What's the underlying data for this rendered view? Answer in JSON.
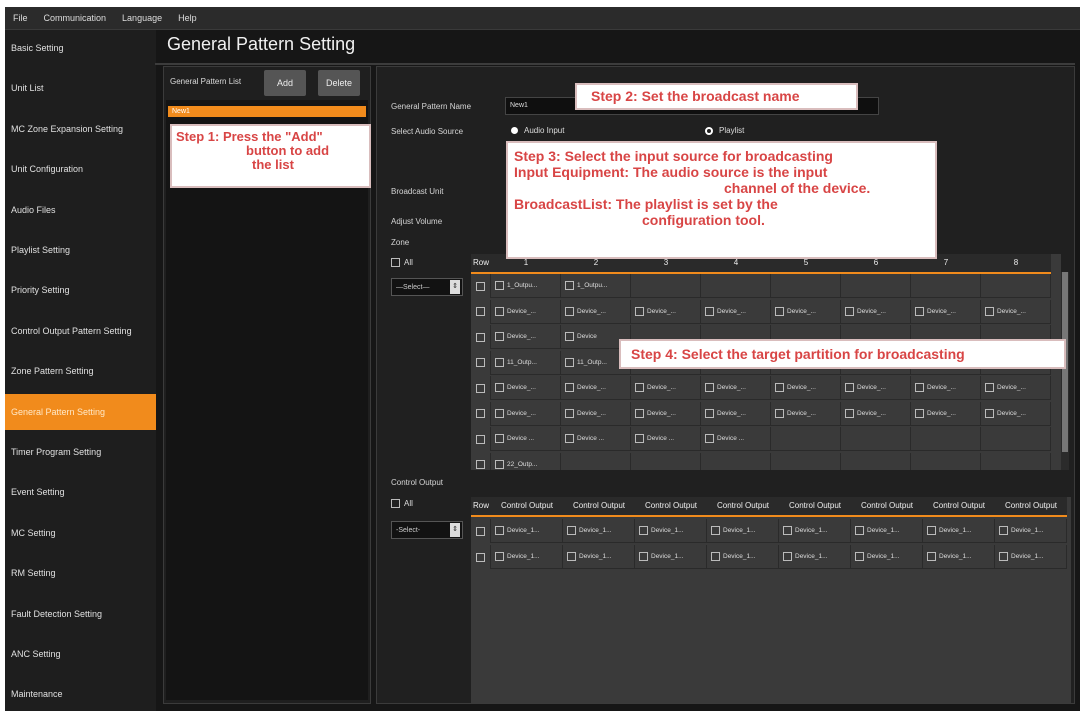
{
  "menu": [
    "File",
    "Communication",
    "Language",
    "Help"
  ],
  "sidebar": {
    "items": [
      {
        "label": "Basic Setting"
      },
      {
        "label": "Unit List"
      },
      {
        "label": "MC Zone Expansion Setting"
      },
      {
        "label": "Unit Configuration"
      },
      {
        "label": "Audio Files"
      },
      {
        "label": "Playlist Setting"
      },
      {
        "label": "Priority Setting"
      },
      {
        "label": "Control Output Pattern Setting"
      },
      {
        "label": "Zone Pattern Setting"
      },
      {
        "label": "General Pattern Setting",
        "active": true
      },
      {
        "label": "Timer Program Setting"
      },
      {
        "label": "Event Setting"
      },
      {
        "label": "MC Setting"
      },
      {
        "label": "RM Setting"
      },
      {
        "label": "Fault Detection Setting"
      },
      {
        "label": "ANC Setting"
      },
      {
        "label": "Maintenance"
      }
    ]
  },
  "page_title": "General Pattern Setting",
  "list_panel": {
    "label": "General Pattern List",
    "add_label": "Add",
    "delete_label": "Delete",
    "items": [
      "New1"
    ]
  },
  "form": {
    "name_label": "General Pattern Name",
    "name_value": "New1",
    "audio_source_label": "Select Audio Source",
    "audio_input_label": "Audio Input",
    "playlist_label": "Playlist",
    "broadcast_unit_label": "Broadcast Unit",
    "adjust_volume_label": "Adjust Volume",
    "zone_label": "Zone",
    "all_label": "All",
    "zone_select": "—Select—",
    "control_output_label": "Control Output",
    "co_select": "-Select-"
  },
  "zone_grid": {
    "row_header": "Row",
    "columns": [
      "1",
      "2",
      "3",
      "4",
      "5",
      "6",
      "7",
      "8"
    ],
    "rows": [
      [
        "1_Outpu...",
        "1_Outpu...",
        "",
        "",
        "",
        "",
        "",
        ""
      ],
      [
        "Device_...",
        "Device_...",
        "Device_...",
        "Device_...",
        "Device_...",
        "Device_...",
        "Device_...",
        "Device_..."
      ],
      [
        "Device_...",
        "Device",
        "",
        "",
        "",
        "",
        "",
        ""
      ],
      [
        "11_Outp...",
        "11_Outp...",
        "",
        "",
        "",
        "",
        "",
        ""
      ],
      [
        "Device_...",
        "Device_...",
        "Device_...",
        "Device_...",
        "Device_...",
        "Device_...",
        "Device_...",
        "Device_..."
      ],
      [
        "Device_...",
        "Device_...",
        "Device_...",
        "Device_...",
        "Device_...",
        "Device_...",
        "Device_...",
        "Device_..."
      ],
      [
        "Device ...",
        "Device ...",
        "Device ...",
        "Device ...",
        "",
        "",
        "",
        ""
      ],
      [
        "22_Outp...",
        "",
        "",
        "",
        "",
        "",
        "",
        ""
      ]
    ]
  },
  "co_grid": {
    "row_header": "Row",
    "columns": [
      "Control Output",
      "Control Output",
      "Control Output",
      "Control Output",
      "Control Output",
      "Control Output",
      "Control Output",
      "Control Output"
    ],
    "rows": [
      [
        "Device_1...",
        "Device_1...",
        "Device_1...",
        "Device_1...",
        "Device_1...",
        "Device_1...",
        "Device_1...",
        "Device_1..."
      ],
      [
        "Device_1...",
        "Device_1...",
        "Device_1...",
        "Device_1...",
        "Device_1...",
        "Device_1...",
        "Device_1...",
        "Device_1..."
      ]
    ]
  },
  "callouts": {
    "step1": "Step 1: Press the \"Add\"",
    "step1_b": "button to add",
    "step1_c": "the list",
    "step2": "Step 2: Set the broadcast name",
    "step3_a": "Step 3: Select the input source for broadcasting",
    "step3_b": "Input Equipment: The audio source is the input",
    "step3_c": "channel of the device.",
    "step3_d": "BroadcastList: The playlist is set by the",
    "step3_e": "configuration tool.",
    "step4": "Step 4: Select the target partition for broadcasting"
  },
  "colors": {
    "accent": "#f18b1c",
    "callout_text": "#d84545"
  }
}
